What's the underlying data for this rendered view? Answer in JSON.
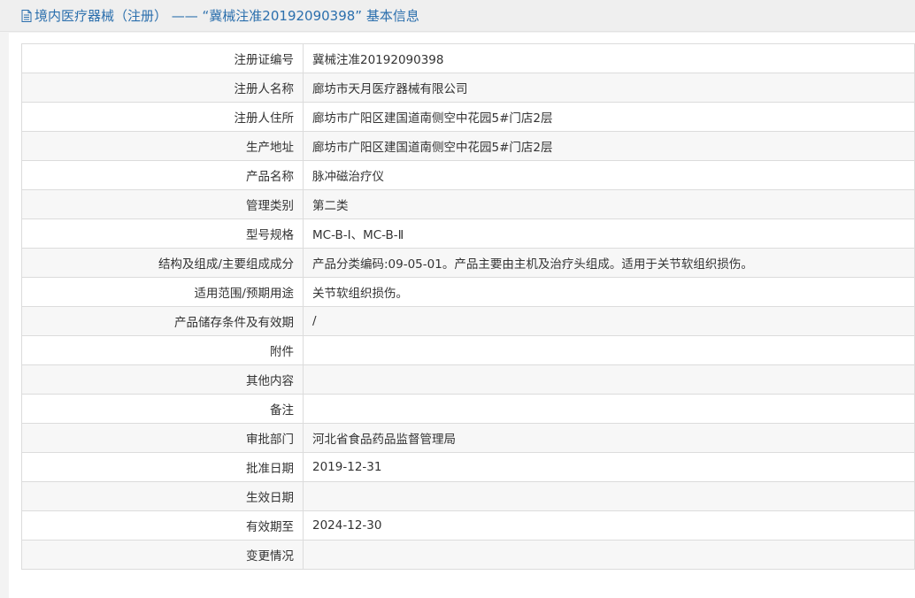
{
  "header": {
    "title": "境内医疗器械（注册） ——  “冀械注准20192090398” 基本信息",
    "icon": "document-icon"
  },
  "rows": [
    {
      "label": "注册证编号",
      "value": "冀械注准20192090398"
    },
    {
      "label": "注册人名称",
      "value": "廊坊市天月医疗器械有限公司"
    },
    {
      "label": "注册人住所",
      "value": "廊坊市广阳区建国道南侧空中花园5#门店2层"
    },
    {
      "label": "生产地址",
      "value": "廊坊市广阳区建国道南侧空中花园5#门店2层"
    },
    {
      "label": "产品名称",
      "value": "脉冲磁治疗仪"
    },
    {
      "label": "管理类别",
      "value": "第二类"
    },
    {
      "label": "型号规格",
      "value": "MC-B-Ⅰ、MC-B-Ⅱ"
    },
    {
      "label": "结构及组成/主要组成成分",
      "value": "产品分类编码:09-05-01。产品主要由主机及治疗头组成。适用于关节软组织损伤。"
    },
    {
      "label": "适用范围/预期用途",
      "value": "关节软组织损伤。"
    },
    {
      "label": "产品储存条件及有效期",
      "value": "/"
    },
    {
      "label": "附件",
      "value": ""
    },
    {
      "label": "其他内容",
      "value": ""
    },
    {
      "label": "备注",
      "value": ""
    },
    {
      "label": "审批部门",
      "value": "河北省食品药品监督管理局"
    },
    {
      "label": "批准日期",
      "value": "2019-12-31"
    },
    {
      "label": "生效日期",
      "value": ""
    },
    {
      "label": "有效期至",
      "value": "2024-12-30"
    },
    {
      "label": "变更情况",
      "value": ""
    }
  ]
}
